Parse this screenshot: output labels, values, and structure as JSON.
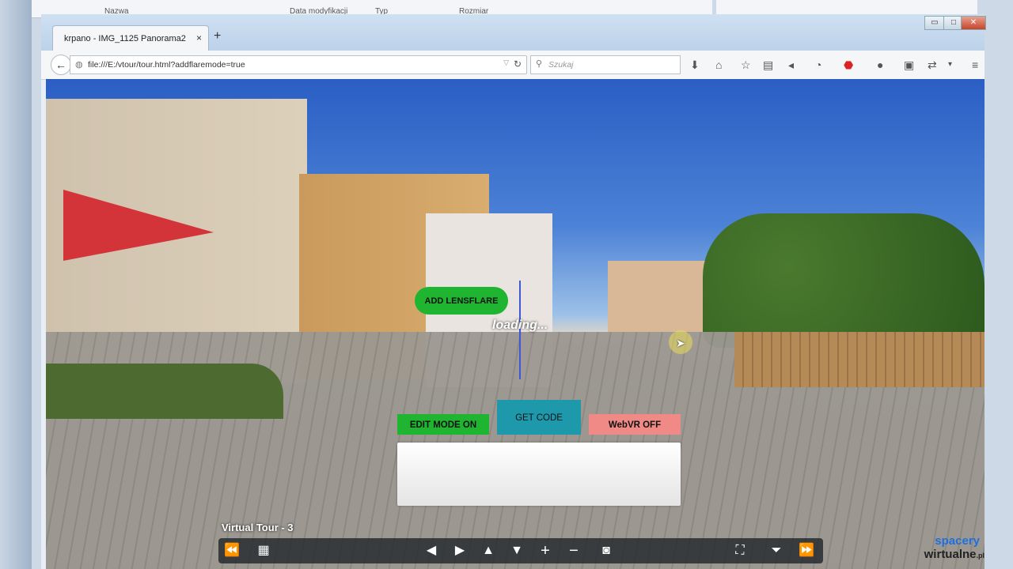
{
  "background_window": {
    "col_name": "Nazwa",
    "col_modified": "Data modyfikacji",
    "col_type": "Typ",
    "col_size": "Rozmiar"
  },
  "browser": {
    "tab_title": "krpano - IMG_1125 Panorama2",
    "tab_close": "×",
    "new_tab": "+",
    "window_controls": {
      "minimize": "▭",
      "maximize": "□",
      "close": "✕"
    },
    "url": "file:///E:/vtour/tour.html?addflaremode=true",
    "search_placeholder": "Szukaj",
    "toolbar_icons": [
      "download-icon",
      "home-icon",
      "bookmark-star-icon",
      "reading-list-icon",
      "pocket-icon",
      "sync-icon",
      "adblock-icon",
      "chat-icon",
      "lock-icon",
      "extension-icon",
      "menu-icon"
    ]
  },
  "viewer": {
    "add_lensflare_label": "ADD LENSFLARE",
    "loading_text": "loading...",
    "edit_mode_label": "EDIT MODE ON",
    "get_code_label": "GET CODE",
    "webvr_label": "WebVR OFF",
    "tour_title": "Virtual Tour - 3",
    "brand_line1": "spacery",
    "brand_line2": "wirtualne",
    "brand_suffix": ".pl",
    "colors": {
      "green": "#20b530",
      "teal": "#1e99ac",
      "pink": "#f08a86"
    },
    "controls": [
      {
        "name": "prev-scene-icon",
        "glyph": "⏪"
      },
      {
        "name": "thumbnails-icon",
        "glyph": "▦"
      },
      {
        "name": "arrow-left-icon",
        "glyph": "◀"
      },
      {
        "name": "arrow-right-icon",
        "glyph": "▶"
      },
      {
        "name": "arrow-up-icon",
        "glyph": "▲"
      },
      {
        "name": "arrow-down-icon",
        "glyph": "▼"
      },
      {
        "name": "zoom-in-icon",
        "glyph": "+"
      },
      {
        "name": "zoom-out-icon",
        "glyph": "−"
      },
      {
        "name": "vr-glasses-icon",
        "glyph": "◙"
      },
      {
        "name": "fullscreen-icon",
        "glyph": "⛶"
      },
      {
        "name": "hide-bar-icon",
        "glyph": "⏷"
      },
      {
        "name": "next-scene-icon",
        "glyph": "⏩"
      }
    ]
  }
}
